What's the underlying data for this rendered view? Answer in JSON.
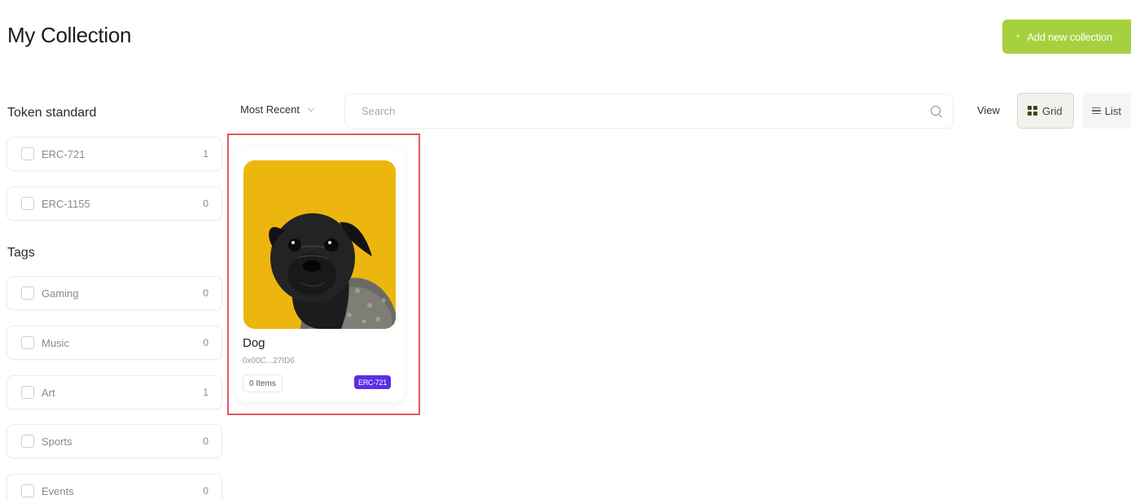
{
  "header": {
    "title": "My Collection",
    "add_button_label": "Add new collection",
    "add_button_icon": "+",
    "accent_color": "#a6d13f"
  },
  "filters": {
    "token_standard_heading": "Token standard",
    "token_standards": [
      {
        "label": "ERC-721",
        "count": "1"
      },
      {
        "label": "ERC-1155",
        "count": "0"
      }
    ],
    "tags_heading": "Tags",
    "tags": [
      {
        "label": "Gaming",
        "count": "0"
      },
      {
        "label": "Music",
        "count": "0"
      },
      {
        "label": "Art",
        "count": "1"
      },
      {
        "label": "Sports",
        "count": "0"
      },
      {
        "label": "Events",
        "count": "0"
      }
    ]
  },
  "toolbar": {
    "sort_label": "Most Recent",
    "search_placeholder": "Search",
    "search_value": "",
    "view_label": "View",
    "grid_label": "Grid",
    "list_label": "List",
    "active_view": "grid"
  },
  "collections": [
    {
      "name": "Dog",
      "address": "0x00C...27ID6",
      "items": "0 Items",
      "standard": "ERC-721",
      "image": "pug-dog",
      "image_bg_color": "#edb60e",
      "standard_color": "#5a2ee8"
    }
  ]
}
